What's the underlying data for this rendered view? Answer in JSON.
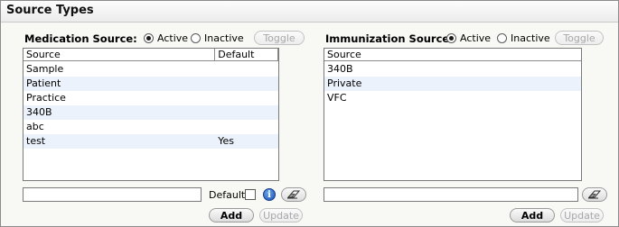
{
  "window": {
    "title": "Source Types"
  },
  "medication": {
    "label": "Medication Source:",
    "radio_active": "Active",
    "radio_inactive": "Inactive",
    "toggle_label": "Toggle",
    "columns": [
      "Source",
      "Default"
    ],
    "rows": [
      [
        "Sample",
        ""
      ],
      [
        "Patient",
        ""
      ],
      [
        "Practice",
        ""
      ],
      [
        "340B",
        ""
      ],
      [
        "abc",
        ""
      ],
      [
        "test",
        "Yes"
      ]
    ],
    "text_value": "",
    "default_label": "Default:",
    "add_label": "Add",
    "update_label": "Update"
  },
  "immunization": {
    "label": "Immunization Source:",
    "radio_active": "Active",
    "radio_inactive": "Inactive",
    "toggle_label": "Toggle",
    "columns": [
      "Source"
    ],
    "rows": [
      [
        "340B"
      ],
      [
        "Private"
      ],
      [
        "VFC"
      ]
    ],
    "text_value": "",
    "add_label": "Add",
    "update_label": "Update"
  },
  "icons": {
    "info": "info-icon",
    "eraser": "eraser-icon"
  }
}
